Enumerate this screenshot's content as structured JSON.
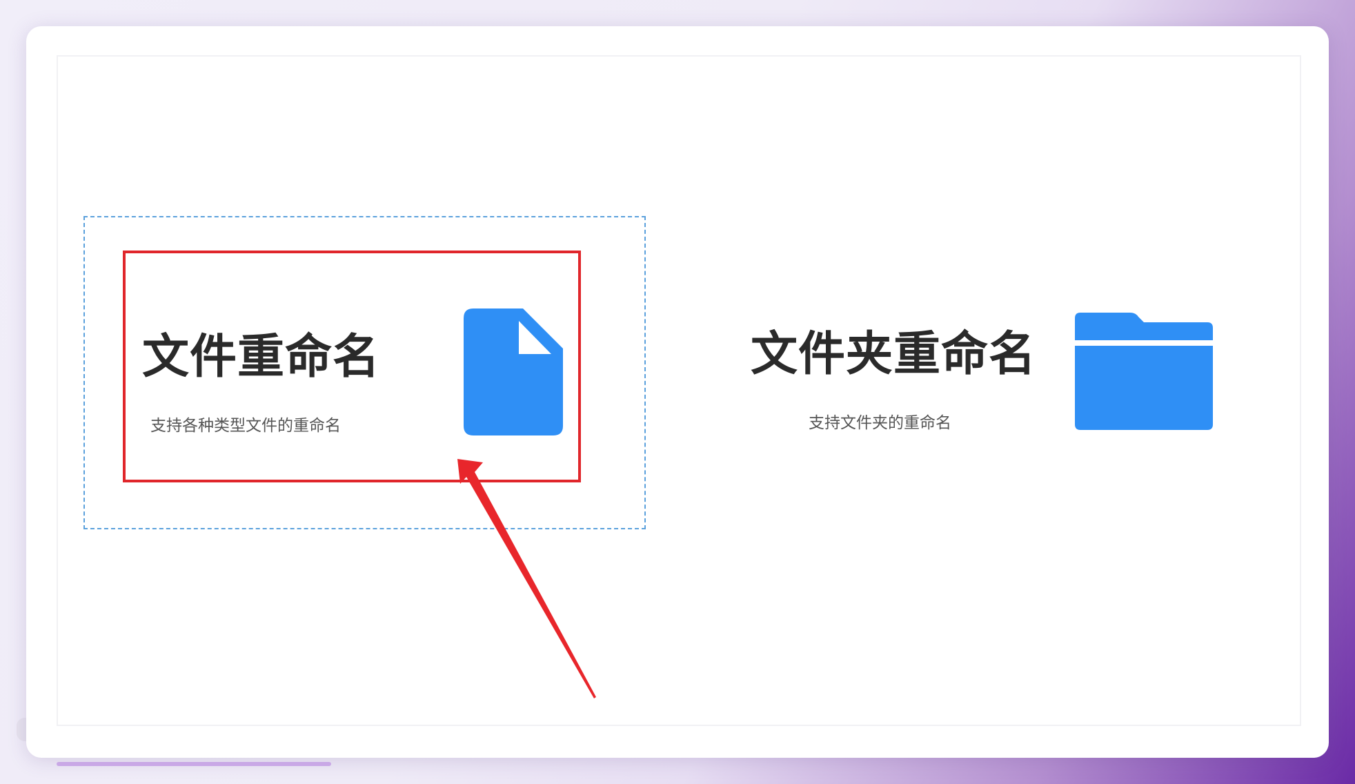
{
  "cards": [
    {
      "title": "文件重命名",
      "subtitle": "支持各种类型文件的重命名",
      "icon": "file-icon",
      "selected": true
    },
    {
      "title": "文件夹重命名",
      "subtitle": "支持文件夹的重命名",
      "icon": "folder-icon",
      "selected": false
    }
  ],
  "colors": {
    "accent": "#2f8ff5",
    "highlight": "#e0262b",
    "selection": "#5aa0dc",
    "title_text": "#2a2a2a",
    "subtitle_text": "#555555"
  },
  "annotation": {
    "icon": "arrow-icon",
    "color": "#e8262b"
  }
}
